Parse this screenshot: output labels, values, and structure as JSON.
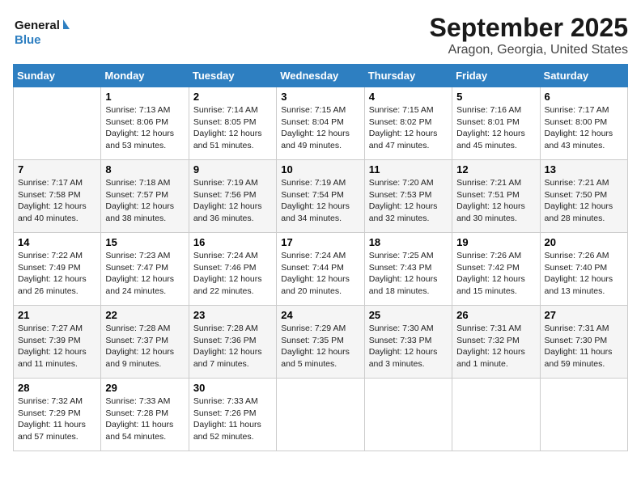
{
  "logo": {
    "text_general": "General",
    "text_blue": "Blue"
  },
  "title": "September 2025",
  "subtitle": "Aragon, Georgia, United States",
  "days_of_week": [
    "Sunday",
    "Monday",
    "Tuesday",
    "Wednesday",
    "Thursday",
    "Friday",
    "Saturday"
  ],
  "weeks": [
    [
      {
        "day": "",
        "info": ""
      },
      {
        "day": "1",
        "info": "Sunrise: 7:13 AM\nSunset: 8:06 PM\nDaylight: 12 hours\nand 53 minutes."
      },
      {
        "day": "2",
        "info": "Sunrise: 7:14 AM\nSunset: 8:05 PM\nDaylight: 12 hours\nand 51 minutes."
      },
      {
        "day": "3",
        "info": "Sunrise: 7:15 AM\nSunset: 8:04 PM\nDaylight: 12 hours\nand 49 minutes."
      },
      {
        "day": "4",
        "info": "Sunrise: 7:15 AM\nSunset: 8:02 PM\nDaylight: 12 hours\nand 47 minutes."
      },
      {
        "day": "5",
        "info": "Sunrise: 7:16 AM\nSunset: 8:01 PM\nDaylight: 12 hours\nand 45 minutes."
      },
      {
        "day": "6",
        "info": "Sunrise: 7:17 AM\nSunset: 8:00 PM\nDaylight: 12 hours\nand 43 minutes."
      }
    ],
    [
      {
        "day": "7",
        "info": "Sunrise: 7:17 AM\nSunset: 7:58 PM\nDaylight: 12 hours\nand 40 minutes."
      },
      {
        "day": "8",
        "info": "Sunrise: 7:18 AM\nSunset: 7:57 PM\nDaylight: 12 hours\nand 38 minutes."
      },
      {
        "day": "9",
        "info": "Sunrise: 7:19 AM\nSunset: 7:56 PM\nDaylight: 12 hours\nand 36 minutes."
      },
      {
        "day": "10",
        "info": "Sunrise: 7:19 AM\nSunset: 7:54 PM\nDaylight: 12 hours\nand 34 minutes."
      },
      {
        "day": "11",
        "info": "Sunrise: 7:20 AM\nSunset: 7:53 PM\nDaylight: 12 hours\nand 32 minutes."
      },
      {
        "day": "12",
        "info": "Sunrise: 7:21 AM\nSunset: 7:51 PM\nDaylight: 12 hours\nand 30 minutes."
      },
      {
        "day": "13",
        "info": "Sunrise: 7:21 AM\nSunset: 7:50 PM\nDaylight: 12 hours\nand 28 minutes."
      }
    ],
    [
      {
        "day": "14",
        "info": "Sunrise: 7:22 AM\nSunset: 7:49 PM\nDaylight: 12 hours\nand 26 minutes."
      },
      {
        "day": "15",
        "info": "Sunrise: 7:23 AM\nSunset: 7:47 PM\nDaylight: 12 hours\nand 24 minutes."
      },
      {
        "day": "16",
        "info": "Sunrise: 7:24 AM\nSunset: 7:46 PM\nDaylight: 12 hours\nand 22 minutes."
      },
      {
        "day": "17",
        "info": "Sunrise: 7:24 AM\nSunset: 7:44 PM\nDaylight: 12 hours\nand 20 minutes."
      },
      {
        "day": "18",
        "info": "Sunrise: 7:25 AM\nSunset: 7:43 PM\nDaylight: 12 hours\nand 18 minutes."
      },
      {
        "day": "19",
        "info": "Sunrise: 7:26 AM\nSunset: 7:42 PM\nDaylight: 12 hours\nand 15 minutes."
      },
      {
        "day": "20",
        "info": "Sunrise: 7:26 AM\nSunset: 7:40 PM\nDaylight: 12 hours\nand 13 minutes."
      }
    ],
    [
      {
        "day": "21",
        "info": "Sunrise: 7:27 AM\nSunset: 7:39 PM\nDaylight: 12 hours\nand 11 minutes."
      },
      {
        "day": "22",
        "info": "Sunrise: 7:28 AM\nSunset: 7:37 PM\nDaylight: 12 hours\nand 9 minutes."
      },
      {
        "day": "23",
        "info": "Sunrise: 7:28 AM\nSunset: 7:36 PM\nDaylight: 12 hours\nand 7 minutes."
      },
      {
        "day": "24",
        "info": "Sunrise: 7:29 AM\nSunset: 7:35 PM\nDaylight: 12 hours\nand 5 minutes."
      },
      {
        "day": "25",
        "info": "Sunrise: 7:30 AM\nSunset: 7:33 PM\nDaylight: 12 hours\nand 3 minutes."
      },
      {
        "day": "26",
        "info": "Sunrise: 7:31 AM\nSunset: 7:32 PM\nDaylight: 12 hours\nand 1 minute."
      },
      {
        "day": "27",
        "info": "Sunrise: 7:31 AM\nSunset: 7:30 PM\nDaylight: 11 hours\nand 59 minutes."
      }
    ],
    [
      {
        "day": "28",
        "info": "Sunrise: 7:32 AM\nSunset: 7:29 PM\nDaylight: 11 hours\nand 57 minutes."
      },
      {
        "day": "29",
        "info": "Sunrise: 7:33 AM\nSunset: 7:28 PM\nDaylight: 11 hours\nand 54 minutes."
      },
      {
        "day": "30",
        "info": "Sunrise: 7:33 AM\nSunset: 7:26 PM\nDaylight: 11 hours\nand 52 minutes."
      },
      {
        "day": "",
        "info": ""
      },
      {
        "day": "",
        "info": ""
      },
      {
        "day": "",
        "info": ""
      },
      {
        "day": "",
        "info": ""
      }
    ]
  ]
}
